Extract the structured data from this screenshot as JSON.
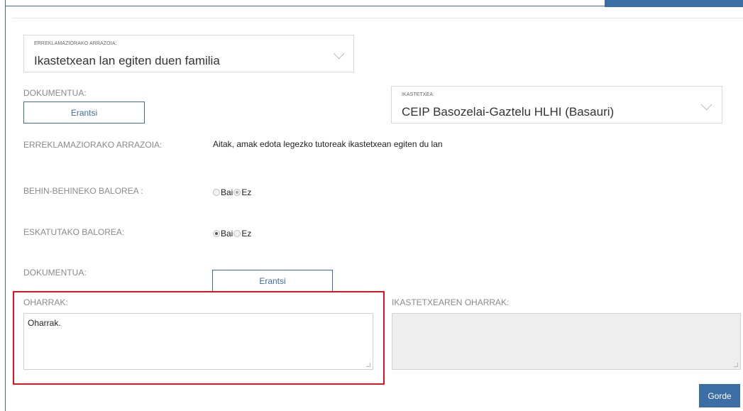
{
  "reason_select": {
    "label": "ERREKLAMAZIORAKO ARRAZOIA:",
    "value": "Ikastetxean lan egiten duen familia",
    "icon": "chevron-down-icon"
  },
  "document_1": {
    "label": "DOKUMENTUA:",
    "button_label": "Erantsi"
  },
  "school_select": {
    "label": "IKASTETXEA:",
    "value": "CEIP Basozelai-Gaztelu HLHI (Basauri)",
    "icon": "chevron-down-icon"
  },
  "reason_row": {
    "label": "ERREKLAMAZIORAKO ARRAZOIA:",
    "value": "Aitak, amak edota legezko tutoreak ikastetxean egiten du lan"
  },
  "provisional": {
    "label": "BEHIN-BEHINEKO BALOREA :",
    "options": [
      "Bai",
      "Ez"
    ],
    "selected": "Ez"
  },
  "requested": {
    "label": "ESKATUTAKO BALOREA:",
    "options": [
      "Bai",
      "Ez"
    ],
    "selected": "Bai"
  },
  "document_2": {
    "label": "DOKUMENTUA:",
    "button_label": "Erantsi"
  },
  "notes": {
    "label": "OHARRAK:",
    "value": "Oharrak."
  },
  "school_notes": {
    "label": "IKASTETXEAREN OHARRAK:",
    "value": ""
  },
  "save_button": {
    "label": "Gorde"
  },
  "colors": {
    "accent": "#3a6ea5",
    "highlight": "#e0141e",
    "label_grey": "#8a8a8a"
  }
}
